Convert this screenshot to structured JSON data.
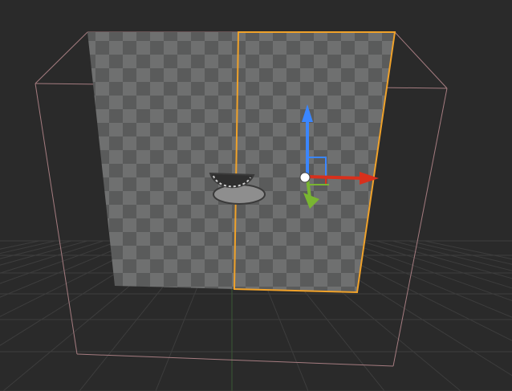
{
  "viewport": {
    "background_color": "#2a2a2a",
    "grid_line_color": "#3d3d3d",
    "grid_axis_y_color": "#3b5a34"
  },
  "scene": {
    "bounding_box_color": "#a57c80",
    "panel_light_color": "#6f7070",
    "panel_dark_color": "#5a5b5b",
    "selection_outline_color": "#f0a22a",
    "object_icon_color": "#9a9a9a"
  },
  "gizmo": {
    "z_axis_color": "#3a86ff",
    "x_axis_color": "#d8301c",
    "y_axis_color": "#79b531",
    "center_color": "#ffffff",
    "icons": [
      "move-up-arrow-icon",
      "move-right-arrow-icon",
      "move-forward-arrow-icon",
      "pivot-center-icon"
    ]
  }
}
